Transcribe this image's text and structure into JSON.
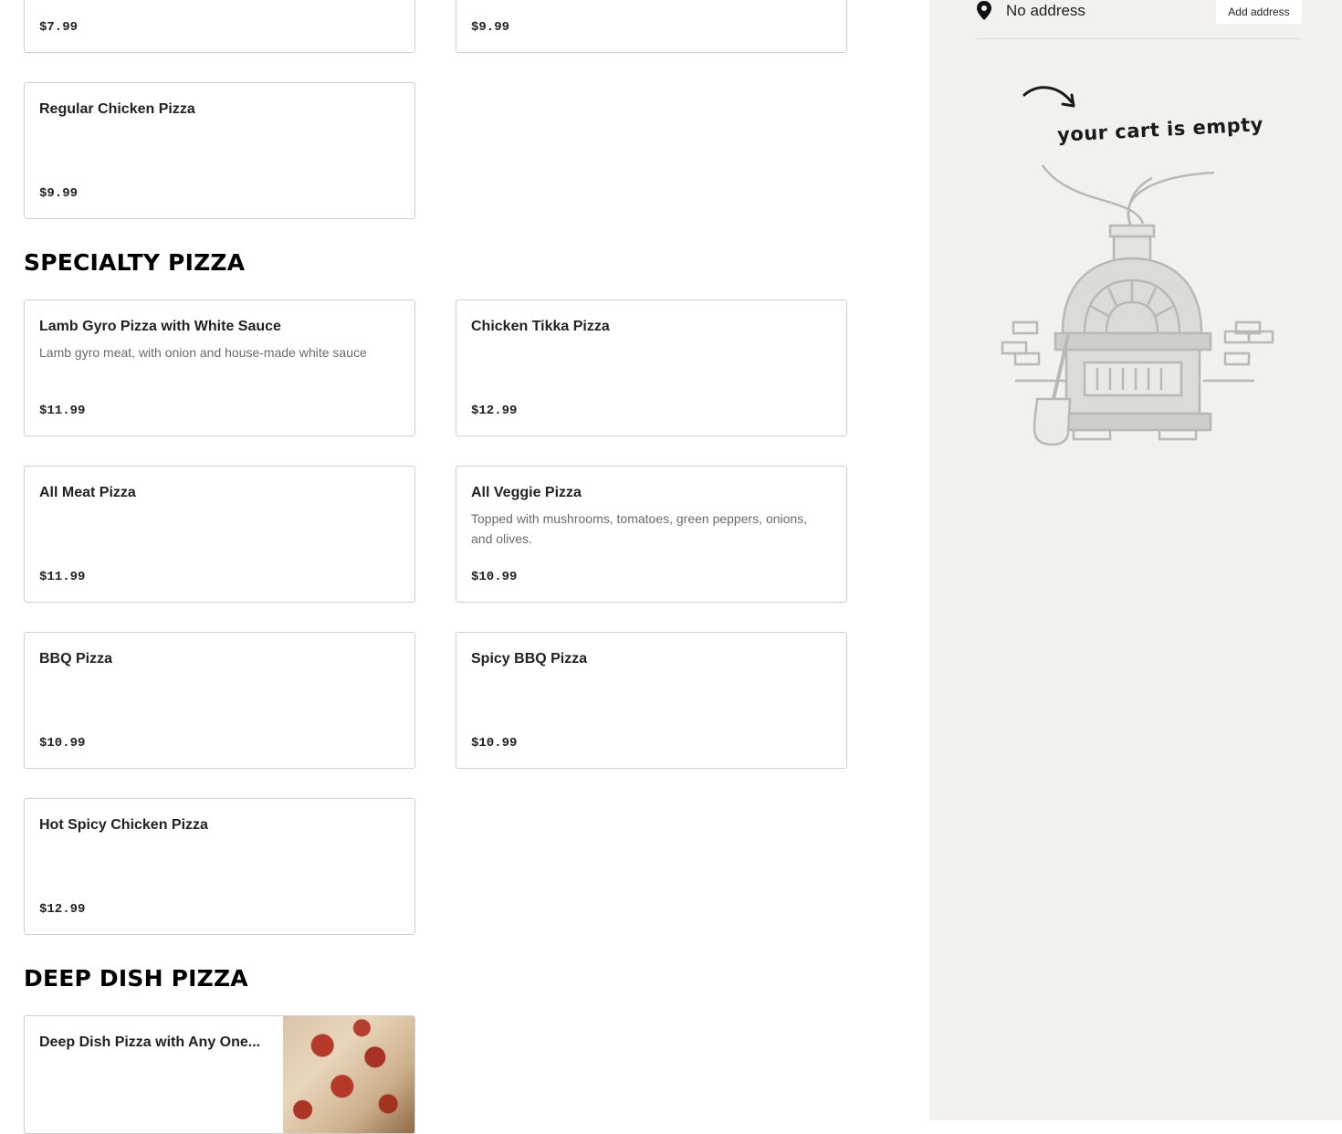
{
  "menu": {
    "top_row": [
      {
        "price": "$7.99"
      },
      {
        "price": "$9.99"
      }
    ],
    "regular_items": [
      {
        "name": "Regular Chicken Pizza",
        "price": "$9.99"
      }
    ],
    "specialty": {
      "title": "SPECIALTY PIZZA",
      "items": [
        {
          "name": "Lamb Gyro Pizza with White Sauce",
          "description": "Lamb gyro meat, with onion and house-made white sauce",
          "price": "$11.99"
        },
        {
          "name": "Chicken Tikka Pizza",
          "description": "",
          "price": "$12.99"
        },
        {
          "name": "All Meat Pizza",
          "description": "",
          "price": "$11.99"
        },
        {
          "name": "All Veggie Pizza",
          "description": "Topped with mushrooms, tomatoes, green peppers, onions, and olives.",
          "price": "$10.99"
        },
        {
          "name": "BBQ Pizza",
          "description": "",
          "price": "$10.99"
        },
        {
          "name": "Spicy BBQ Pizza",
          "description": "",
          "price": "$10.99"
        },
        {
          "name": "Hot Spicy Chicken Pizza",
          "description": "",
          "price": "$12.99"
        }
      ]
    },
    "deep_dish": {
      "title": "DEEP DISH PIZZA",
      "items": [
        {
          "name": "Deep Dish Pizza with Any One...",
          "price": ""
        }
      ]
    }
  },
  "cart": {
    "address_text": "No address",
    "add_address_label": "Add address",
    "empty_message": "your cart is empty",
    "icons": {
      "address": "location-pin-icon",
      "arrow": "hand-drawn-arrow-icon",
      "illustration": "pizza-oven-illustration"
    }
  },
  "colors": {
    "sidebar_bg": "#f2f1ee",
    "card_border": "#cfcfcf",
    "text": "#1f1f1f",
    "muted": "#6b6b6b"
  }
}
